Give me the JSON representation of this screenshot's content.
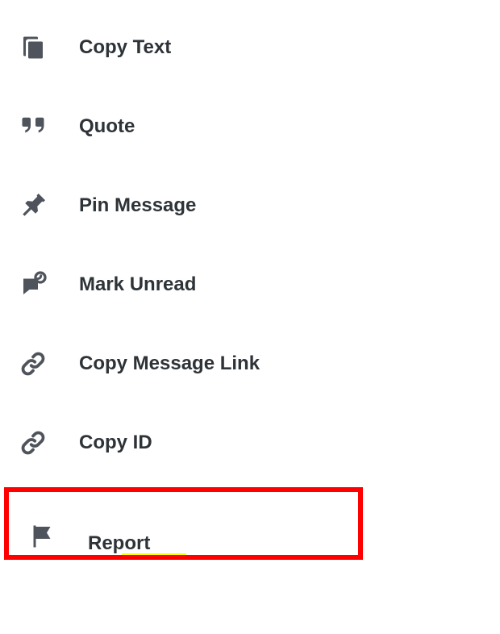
{
  "menu": {
    "copy_text": {
      "label": "Copy Text"
    },
    "quote": {
      "label": "Quote"
    },
    "pin_message": {
      "label": "Pin Message"
    },
    "mark_unread": {
      "label": "Mark Unread"
    },
    "copy_message_link": {
      "label": "Copy Message Link"
    },
    "copy_id": {
      "label": "Copy ID"
    },
    "report": {
      "label": "Report"
    }
  }
}
